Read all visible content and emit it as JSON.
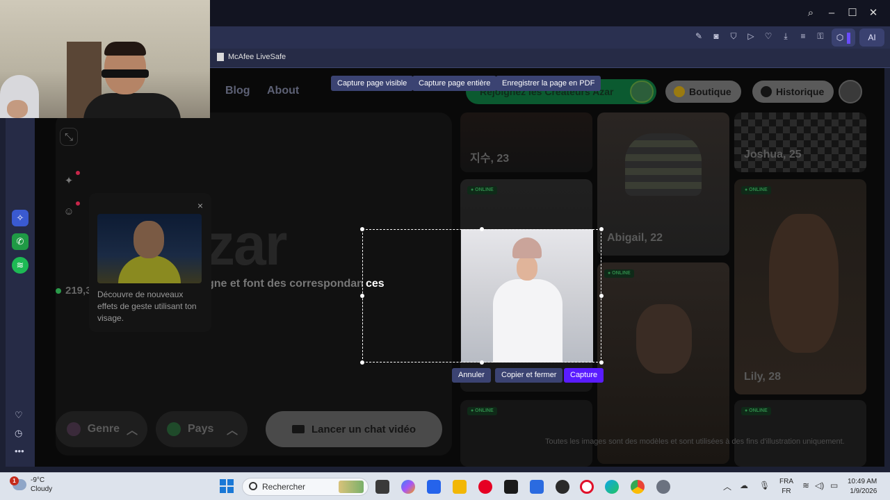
{
  "browser": {
    "bookmark": "McAfee LiveSafe",
    "ai_label": "AI",
    "toolbar_icons": [
      "edit-icon",
      "camera-icon",
      "shield-icon",
      "play-icon",
      "heart-icon",
      "download-icon",
      "menu-lines-icon",
      "lock-icon"
    ]
  },
  "capture_toolbar": {
    "visible": "Capture page visible",
    "full": "Capture page entière",
    "pdf": "Enregistrer la page en PDF"
  },
  "azar": {
    "nav": {
      "blog": "Blog",
      "about": "About"
    },
    "creators_banner": "Rejoignez les Créateurs Azar",
    "shop": "Boutique",
    "history": "Historique",
    "logo_text": "zar",
    "tagline": "gne et font des correspondan",
    "tagline_tail": "ces",
    "online_count": "219,3",
    "popover_text": "Découvre de nouveaux effets de geste utilisant ton visage.",
    "popover_close": "×",
    "genre": "Genre",
    "country": "Pays",
    "start_chat": "Lancer un chat vidéo",
    "online_tag": "● ONLINE",
    "footer_note": "Toutes les images sont des modèles et sont utilisées à des fins d'illustration uniquement.",
    "profiles": [
      {
        "label": "지수, 23"
      },
      {
        "label": "Abigail, 22"
      },
      {
        "label": "Joshua, 25"
      },
      {
        "label": "Lily, 28"
      }
    ]
  },
  "selection": {
    "cancel": "Annuler",
    "copy_close": "Copier et fermer",
    "capture": "Capture"
  },
  "taskbar": {
    "weather_temp": "-9°C",
    "weather_desc": "Cloudy",
    "weather_badge": "1",
    "search_placeholder": "Rechercher",
    "lang_top": "FRA",
    "lang_bottom": "FR",
    "time": "10:49 AM",
    "date": "1/9/2026"
  },
  "colors": {
    "accent": "#5a1cff",
    "capture_btn": "#3b4372",
    "creators_green": "#0b5a30",
    "online_green": "#2f8a4a"
  }
}
